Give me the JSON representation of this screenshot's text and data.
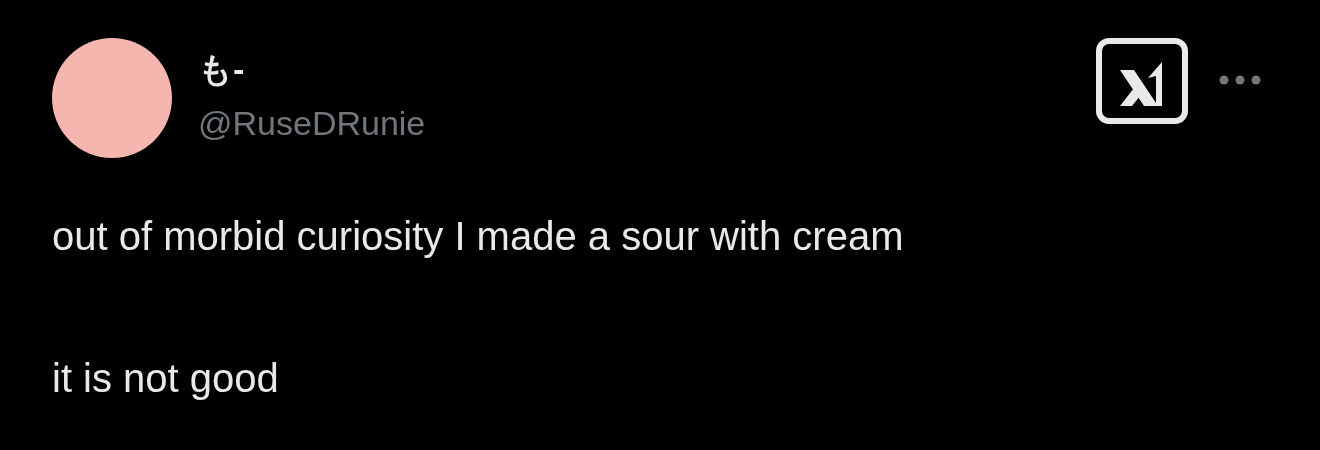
{
  "author": {
    "name": "も-",
    "handle": "@RuseDRunie"
  },
  "paragraphs": [
    "out of morbid curiosity I made a sour with cream",
    "it is not good"
  ]
}
